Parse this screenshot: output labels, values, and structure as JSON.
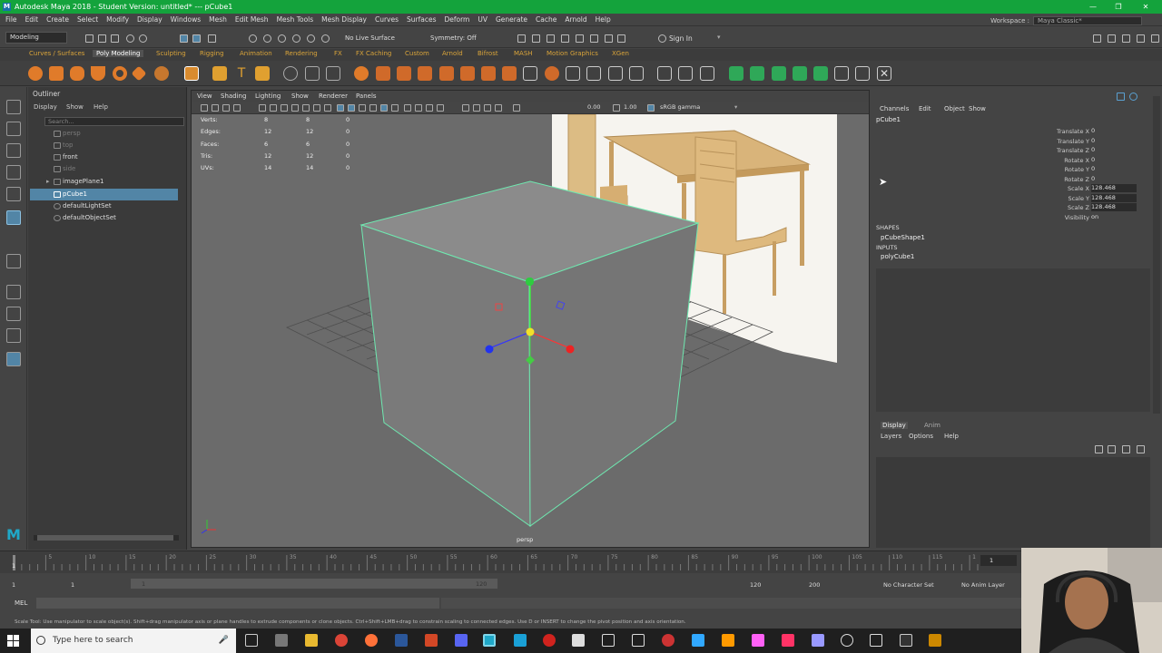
{
  "window": {
    "title": "Autodesk Maya 2018 - Student Version: untitled*   ---   pCube1",
    "logo_letter": "M",
    "controls": [
      "—",
      "❐",
      "✕"
    ]
  },
  "menubar": [
    "File",
    "Edit",
    "Create",
    "Select",
    "Modify",
    "Display",
    "Windows",
    "Mesh",
    "Edit Mesh",
    "Mesh Tools",
    "Mesh Display",
    "Curves",
    "Surfaces",
    "Deform",
    "UV",
    "Generate",
    "Cache",
    "Arnold",
    "Help"
  ],
  "workspace": {
    "label": "Workspace :",
    "value": "Maya Classic*"
  },
  "statusline": {
    "mode": "Modeling",
    "live_surface": "No Live Surface",
    "symmetry": "Symmetry: Off",
    "signin": "Sign In"
  },
  "shelf_tabs": [
    "Curves / Surfaces",
    "Poly Modeling",
    "Sculpting",
    "Rigging",
    "Animation",
    "Rendering",
    "FX",
    "FX Caching",
    "Custom",
    "Arnold",
    "Bifrost",
    "MASH",
    "Motion Graphics",
    "XGen"
  ],
  "outliner": {
    "title": "Outliner",
    "menu": [
      "Display",
      "Show",
      "Help"
    ],
    "search_placeholder": "Search...",
    "items": [
      {
        "label": "persp",
        "dim": true
      },
      {
        "label": "top",
        "dim": true
      },
      {
        "label": "front",
        "dim": false
      },
      {
        "label": "side",
        "dim": true
      },
      {
        "label": "imagePlane1",
        "dim": false
      },
      {
        "label": "pCube1",
        "dim": false,
        "selected": true
      },
      {
        "label": "defaultLightSet",
        "dim": false
      },
      {
        "label": "defaultObjectSet",
        "dim": false
      }
    ]
  },
  "viewport": {
    "menu": [
      "View",
      "Shading",
      "Lighting",
      "Show",
      "Renderer",
      "Panels"
    ],
    "near_value": "0.00",
    "far_value": "1.00",
    "color_space": "sRGB gamma",
    "camera_label": "persp",
    "hud": [
      {
        "label": "Verts:",
        "a": "8",
        "b": "8",
        "c": "0"
      },
      {
        "label": "Edges:",
        "a": "12",
        "b": "12",
        "c": "0"
      },
      {
        "label": "Faces:",
        "a": "6",
        "b": "6",
        "c": "0"
      },
      {
        "label": "Tris:",
        "a": "12",
        "b": "12",
        "c": "0"
      },
      {
        "label": "UVs:",
        "a": "14",
        "b": "14",
        "c": "0"
      }
    ]
  },
  "channelbox": {
    "menu": [
      "Channels",
      "Edit",
      "Object",
      "Show"
    ],
    "object": "pCube1",
    "attributes": [
      {
        "name": "Translate X",
        "value": "0"
      },
      {
        "name": "Translate Y",
        "value": "0"
      },
      {
        "name": "Translate Z",
        "value": "0"
      },
      {
        "name": "Rotate X",
        "value": "0"
      },
      {
        "name": "Rotate Y",
        "value": "0"
      },
      {
        "name": "Rotate Z",
        "value": "0"
      },
      {
        "name": "Scale X",
        "value": "128.468"
      },
      {
        "name": "Scale Y",
        "value": "128.468"
      },
      {
        "name": "Scale Z",
        "value": "128.468"
      },
      {
        "name": "Visibility",
        "value": "on"
      }
    ],
    "shapes_header": "SHAPES",
    "shape": "pCubeShape1",
    "inputs_header": "INPUTS",
    "input": "polyCube1"
  },
  "layers": {
    "tabs": [
      "Display",
      "Anim"
    ],
    "menu": [
      "Layers",
      "Options",
      "Help"
    ]
  },
  "timeline": {
    "ticks": [
      "5",
      "10",
      "15",
      "20",
      "25",
      "30",
      "35",
      "40",
      "45",
      "50",
      "55",
      "60",
      "65",
      "70",
      "75",
      "80",
      "85",
      "90",
      "95",
      "100",
      "105",
      "110",
      "115",
      "1"
    ],
    "current_frame": "1"
  },
  "range": {
    "start": "1",
    "start2": "1",
    "slider_start": "1",
    "slider_end": "120",
    "end": "120",
    "end2": "200",
    "character_set": "No Character Set",
    "anim_layer": "No Anim Layer"
  },
  "cmdline": {
    "label": "MEL"
  },
  "helpline": "Scale Tool: Use manipulator to scale object(s). Shift+drag manipulator axis or plane handles to extrude components or clone objects. Ctrl+Shift+LMB+drag to constrain scaling to connected edges. Use D or INSERT to change the pivot position and axis orientation.",
  "taskbar": {
    "search_placeholder": "Type here to search"
  }
}
